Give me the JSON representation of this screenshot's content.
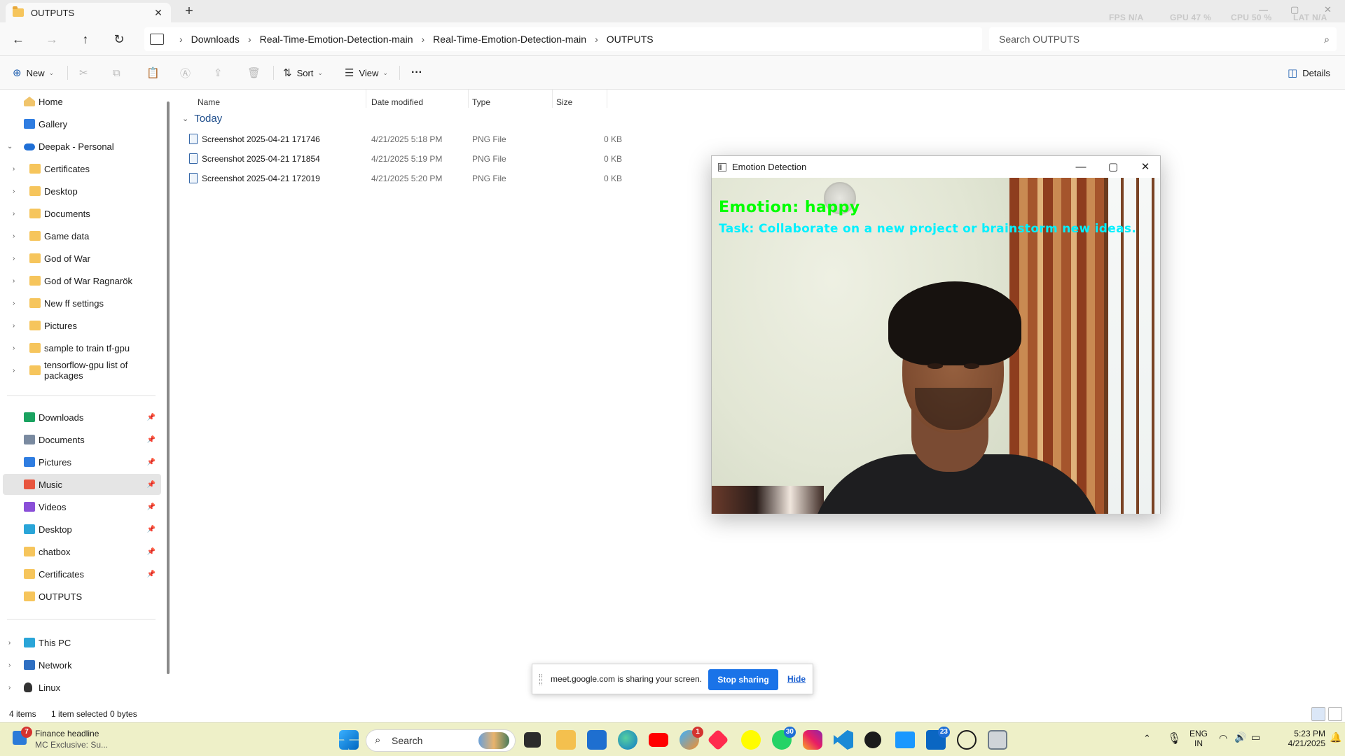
{
  "tab": {
    "title": "OUTPUTS",
    "close": "✕",
    "new": "+"
  },
  "perf": {
    "fps": "FPS N/A",
    "gpu": "GPU 47 %",
    "cpu": "CPU 50 %",
    "lat": "LAT N/A"
  },
  "window_controls": {
    "minimize": "—",
    "maximize": "▢",
    "close": "✕"
  },
  "nav": {
    "back": "←",
    "forward": "→",
    "up": "↑",
    "refresh": "↻"
  },
  "breadcrumbs": [
    "Downloads",
    "Real-Time-Emotion-Detection-main",
    "Real-Time-Emotion-Detection-main",
    "OUTPUTS"
  ],
  "breadcrumb_sep": "›",
  "search": {
    "placeholder": "Search OUTPUTS",
    "icon": "⌕"
  },
  "toolbar": {
    "new": "New",
    "sort": "Sort",
    "view": "View",
    "more": "···",
    "details": "Details",
    "cut_icon": "✂",
    "copy_icon": "⧉",
    "paste_icon": "📋",
    "rename_icon": "Ⓐ",
    "share_icon": "⇪",
    "delete_icon": "🗑",
    "new_icon": "⊕",
    "sort_icon": "⇅",
    "view_icon": "☰",
    "details_icon": "◫"
  },
  "sidebar": {
    "top": [
      {
        "label": "Home",
        "icon": "home-icon"
      },
      {
        "label": "Gallery",
        "icon": "gallery-icon"
      },
      {
        "label": "Deepak - Personal",
        "icon": "cloud-icon"
      }
    ],
    "onedrive": [
      "Certificates",
      "Desktop",
      "Documents",
      "Game data",
      "God of War",
      "God of War Ragnarök",
      "New ff settings",
      "Pictures",
      "sample to train tf-gpu",
      "tensorflow-gpu list of packages"
    ],
    "quick_access": [
      {
        "label": "Downloads",
        "pinned": true
      },
      {
        "label": "Documents",
        "pinned": true
      },
      {
        "label": "Pictures",
        "pinned": true
      },
      {
        "label": "Music",
        "pinned": true,
        "selected": true
      },
      {
        "label": "Videos",
        "pinned": true
      },
      {
        "label": "Desktop",
        "pinned": true
      },
      {
        "label": "chatbox",
        "pinned": true
      },
      {
        "label": "Certificates",
        "pinned": true
      },
      {
        "label": "OUTPUTS",
        "pinned": false
      }
    ],
    "bottom": [
      "This PC",
      "Network",
      "Linux"
    ],
    "pin_glyph": "📌",
    "expand_glyph": "›",
    "collapse_glyph": "⌄"
  },
  "columns": {
    "name": "Name",
    "date": "Date modified",
    "type": "Type",
    "size": "Size"
  },
  "group": {
    "label": "Today",
    "chevron": "⌄"
  },
  "files": [
    {
      "name": "Screenshot 2025-04-21 171746",
      "date": "4/21/2025 5:18 PM",
      "type": "PNG File",
      "size": "0 KB"
    },
    {
      "name": "Screenshot 2025-04-21 171854",
      "date": "4/21/2025 5:19 PM",
      "type": "PNG File",
      "size": "0 KB"
    },
    {
      "name": "Screenshot 2025-04-21 172019",
      "date": "4/21/2025 5:20 PM",
      "type": "PNG File",
      "size": "0 KB"
    }
  ],
  "emotion_window": {
    "title": "Emotion Detection",
    "emotion_text": "Emotion: happy",
    "task_text": "Task: Collaborate on a new project or brainstorm new ideas.",
    "minimize": "—",
    "maximize": "▢",
    "close": "✕"
  },
  "share_bar": {
    "message": "meet.google.com is sharing your screen.",
    "stop": "Stop sharing",
    "hide": "Hide"
  },
  "status": {
    "items": "4 items",
    "selected": "1 item selected  0 bytes"
  },
  "taskbar": {
    "news_title": "Finance headline",
    "news_sub": "MC Exclusive: Su...",
    "news_badge": "7",
    "search_label": "Search",
    "badges": {
      "copilot": "1",
      "whatsapp": "30",
      "linkedin": "23"
    },
    "lang": "ENG",
    "region": "IN",
    "time": "5:23 PM",
    "date": "4/21/2025"
  },
  "colors": {
    "accent": "#1a73e8",
    "folder": "#f6c55c",
    "emotion": "#00ff00",
    "task": "#00f0ff",
    "taskbar": "#eef0c8"
  }
}
